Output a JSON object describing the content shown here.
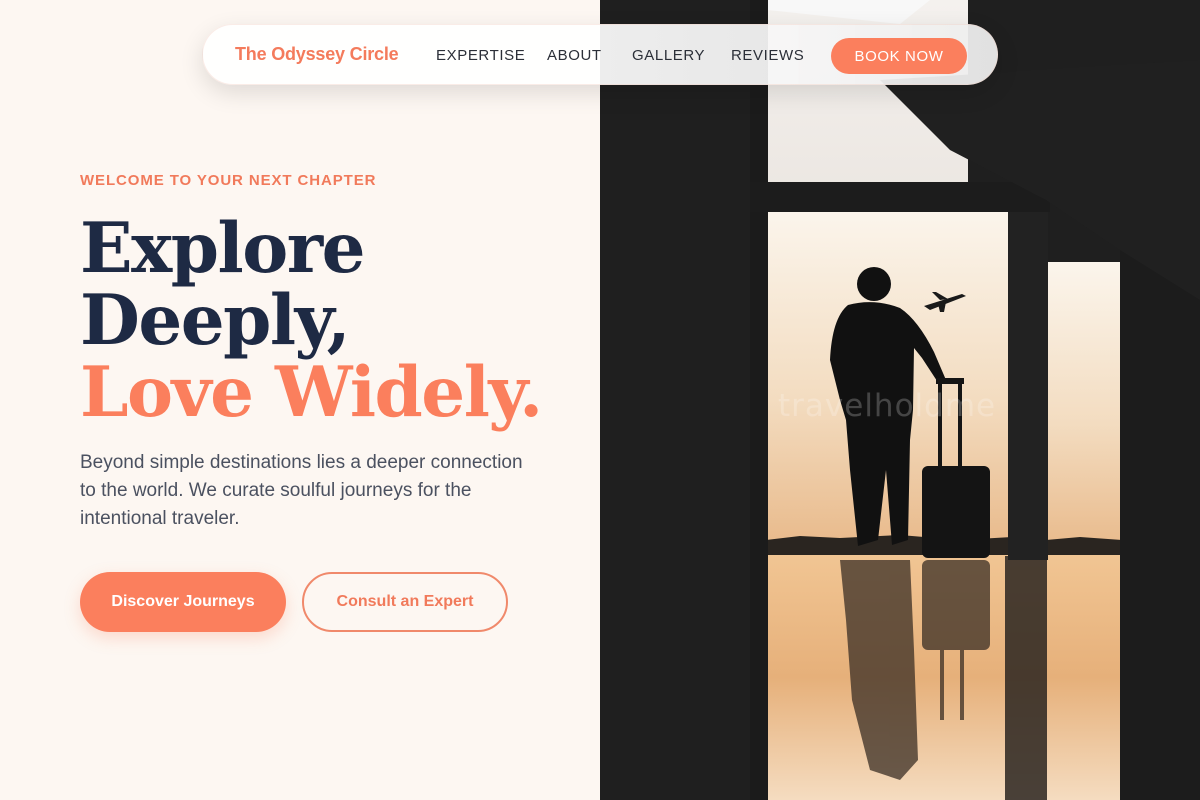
{
  "brand": "The Odyssey Circle",
  "nav": {
    "links": [
      "EXPERTISE",
      "ABOUT",
      "GALLERY",
      "REVIEWS"
    ],
    "cta": "BOOK NOW"
  },
  "hero": {
    "eyebrow": "WELCOME TO YOUR NEXT CHAPTER",
    "headline_line1": "Explore",
    "headline_line2": "Deeply,",
    "headline_line3": "Love Widely.",
    "subtitle": "Beyond simple destinations lies a deeper connection to the world. We curate soulful journeys for the intentional traveler.",
    "primary_button": "Discover Journeys",
    "secondary_button": "Consult an Expert"
  },
  "image": {
    "watermark": "travelholdme",
    "subject_icon": "traveler-silhouette",
    "plane_icon": "airplane-icon"
  },
  "colors": {
    "accent": "#fb7f5d",
    "heading": "#1e2a44",
    "background": "#fdf7f2",
    "body_text": "#4b5160"
  }
}
